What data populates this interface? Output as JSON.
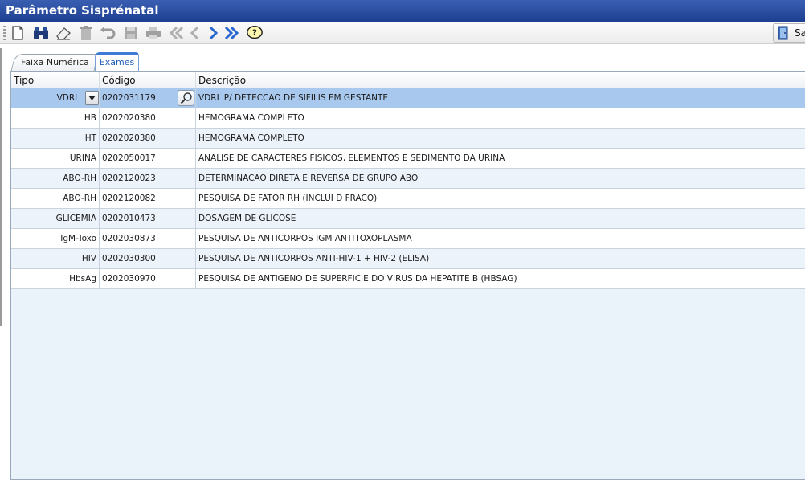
{
  "window": {
    "title": "Parâmetro Sisprénatal"
  },
  "toolbar": {
    "exit_label": "Sa",
    "buttons": [
      {
        "name": "new-button",
        "icon": "new-document-icon"
      },
      {
        "name": "search-button",
        "icon": "binoculars-icon"
      },
      {
        "name": "edit-button",
        "icon": "eraser-icon"
      },
      {
        "name": "delete-button",
        "icon": "trash-icon"
      },
      {
        "name": "undo-button",
        "icon": "undo-icon"
      },
      {
        "name": "save-button",
        "icon": "save-icon"
      },
      {
        "name": "print-button",
        "icon": "printer-icon"
      },
      {
        "name": "first-record-button",
        "icon": "double-chevron-left-icon"
      },
      {
        "name": "previous-record-button",
        "icon": "chevron-left-icon"
      },
      {
        "name": "next-record-button",
        "icon": "chevron-right-icon"
      },
      {
        "name": "last-record-button",
        "icon": "double-chevron-right-icon"
      },
      {
        "name": "help-button",
        "icon": "help-bubble-icon"
      }
    ]
  },
  "tabs": [
    {
      "label": "Faixa Numérica",
      "active": false
    },
    {
      "label": "Exames",
      "active": true
    }
  ],
  "grid": {
    "columns": {
      "tipo": "Tipo",
      "codigo": "Código",
      "descricao": "Descrição"
    },
    "rows": [
      {
        "tipo": "VDRL",
        "codigo": "0202031179",
        "descricao": "VDRL P/ DETECCAO DE SIFILIS EM GESTANTE"
      },
      {
        "tipo": "HB",
        "codigo": "0202020380",
        "descricao": "HEMOGRAMA COMPLETO"
      },
      {
        "tipo": "HT",
        "codigo": "0202020380",
        "descricao": "HEMOGRAMA COMPLETO"
      },
      {
        "tipo": "URINA",
        "codigo": "0202050017",
        "descricao": "ANALISE DE CARACTERES FISICOS, ELEMENTOS E SEDIMENTO DA URINA"
      },
      {
        "tipo": "ABO-RH",
        "codigo": "0202120023",
        "descricao": "DETERMINACAO DIRETA E REVERSA DE GRUPO ABO"
      },
      {
        "tipo": "ABO-RH",
        "codigo": "0202120082",
        "descricao": "PESQUISA DE FATOR RH (INCLUI D FRACO)"
      },
      {
        "tipo": "GLICEMIA",
        "codigo": "0202010473",
        "descricao": "DOSAGEM DE GLICOSE"
      },
      {
        "tipo": "IgM-Toxo",
        "codigo": "0202030873",
        "descricao": "PESQUISA DE ANTICORPOS IGM ANTITOXOPLASMA"
      },
      {
        "tipo": "HIV",
        "codigo": "0202030300",
        "descricao": "PESQUISA DE ANTICORPOS ANTI-HIV-1 + HIV-2 (ELISA)"
      },
      {
        "tipo": "HbsAg",
        "codigo": "0202030970",
        "descricao": "PESQUISA DE ANTIGENO DE SUPERFICIE DO VIRUS DA HEPATITE B (HBSAG)"
      }
    ]
  },
  "colors": {
    "title_bar": "#1d3f91",
    "selected_row": "#a9c8ee",
    "alt_row": "#edf3fa",
    "active_tab": "#3d7bd6"
  }
}
